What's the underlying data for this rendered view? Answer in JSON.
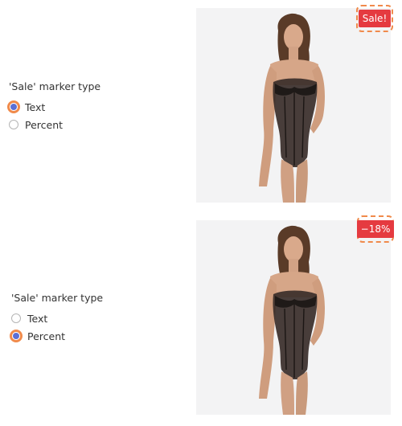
{
  "panels": [
    {
      "setting_label": "'Sale' marker type",
      "options": [
        {
          "label": "Text",
          "selected": true
        },
        {
          "label": "Percent",
          "selected": false
        }
      ],
      "badge": "Sale!",
      "product_image": "product-photo"
    },
    {
      "setting_label": "'Sale' marker type",
      "options": [
        {
          "label": "Text",
          "selected": false
        },
        {
          "label": "Percent",
          "selected": true
        }
      ],
      "badge": "−18%",
      "product_image": "product-photo"
    }
  ],
  "colors": {
    "accent_highlight": "#f08a4b",
    "radio_selected": "#5b6fd6",
    "badge_bg": "#e53a40",
    "image_bg": "#f3f3f4"
  }
}
